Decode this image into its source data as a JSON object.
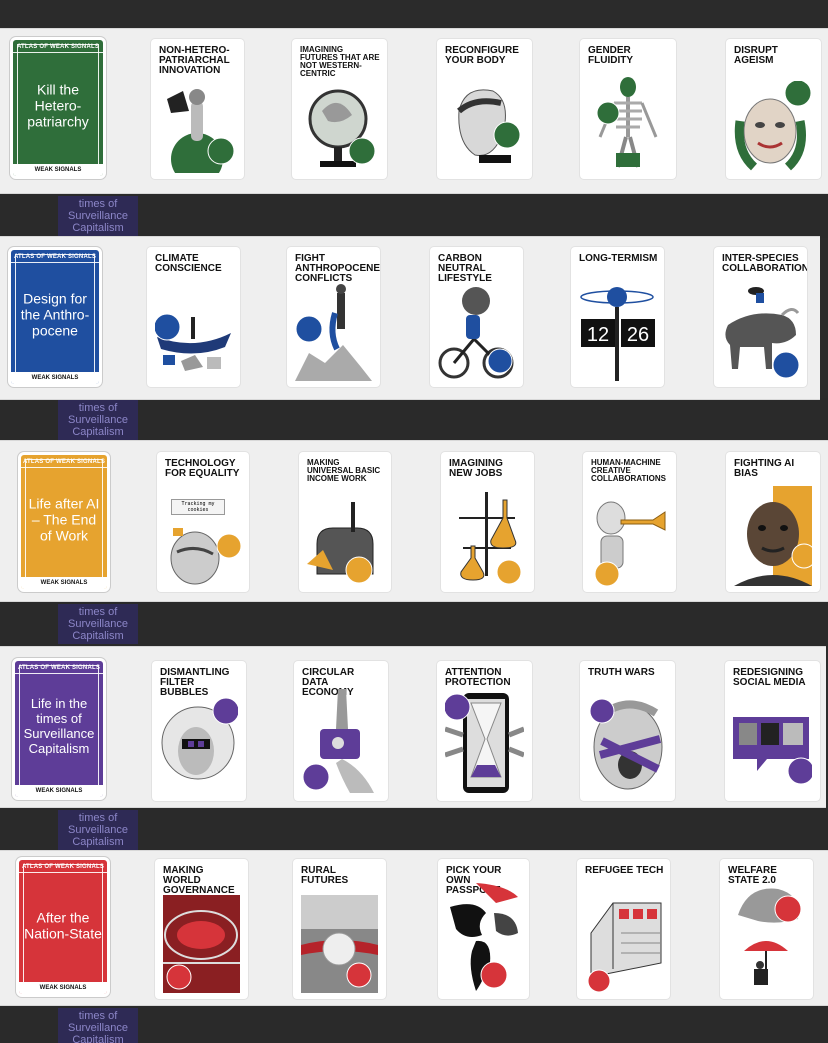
{
  "ghost_caption": "times of Surveillance Capitalism",
  "rows": [
    {
      "accent": "#2f6e3a",
      "cover": {
        "tag": "ATLAS OF WEAK SIGNALS",
        "title": "Kill the Hetero-patriarchy",
        "footer": "WEAK SIGNALS"
      },
      "cards": [
        {
          "title": "NON-HETERO-PATRIARCHAL INNOVATION",
          "icon": "astronaut-icon"
        },
        {
          "title": "IMAGINING FUTURES THAT ARE NOT WESTERN-CENTRIC",
          "icon": "globe-icon"
        },
        {
          "title": "RECONFIGURE YOUR BODY",
          "icon": "cyborg-head-icon"
        },
        {
          "title": "GENDER FLUIDITY",
          "icon": "skeleton-icon"
        },
        {
          "title": "DISRUPT AGEISM",
          "icon": "face-icon"
        }
      ]
    },
    {
      "accent": "#1f4fa0",
      "cover": {
        "tag": "ATLAS OF WEAK SIGNALS",
        "title": "Design for the Anthro-pocene",
        "footer": "WEAK SIGNALS"
      },
      "cards": [
        {
          "title": "CLIMATE CONSCIENCE",
          "icon": "canoe-icon"
        },
        {
          "title": "FIGHT ANTHROPOCENE CONFLICTS",
          "icon": "climber-icon"
        },
        {
          "title": "CARBON NEUTRAL LIFESTYLE",
          "icon": "bicycle-icon"
        },
        {
          "title": "LONG-TERMISM",
          "icon": "flip-clock-icon",
          "clock": [
            "12",
            "26"
          ]
        },
        {
          "title": "INTER-SPECIES COLLABORATION",
          "icon": "buffalo-icon"
        }
      ]
    },
    {
      "accent": "#e6a32f",
      "cover": {
        "tag": "ATLAS OF WEAK SIGNALS",
        "title": "Life after AI – The End of Work",
        "footer": "WEAK SIGNALS"
      },
      "cards": [
        {
          "title": "TECHNOLOGY FOR EQUALITY",
          "icon": "elderly-person-icon",
          "note": "Tracking my cookies"
        },
        {
          "title": "MAKING UNIVERSAL BASIC INCOME WORK",
          "icon": "mailbox-icon"
        },
        {
          "title": "IMAGINING NEW JOBS",
          "icon": "lab-flask-icon"
        },
        {
          "title": "HUMAN-MACHINE CREATIVE COLLABORATIONS",
          "icon": "robot-trumpet-icon"
        },
        {
          "title": "FIGHTING AI BIAS",
          "icon": "split-face-icon"
        }
      ]
    },
    {
      "accent": "#5e3d98",
      "cover": {
        "tag": "ATLAS OF WEAK SIGNALS",
        "title": "Life in the times of Surveillance Capitalism",
        "footer": "WEAK SIGNALS"
      },
      "cards": [
        {
          "title": "DISMANTLING FILTER BUBBLES",
          "icon": "bubble-head-icon"
        },
        {
          "title": "CIRCULAR DATA ECONOMY",
          "icon": "hands-exchange-icon"
        },
        {
          "title": "ATTENTION PROTECTION",
          "icon": "hourglass-phone-icon"
        },
        {
          "title": "TRUTH WARS",
          "icon": "shouting-face-icon"
        },
        {
          "title": "REDESIGNING SOCIAL MEDIA",
          "icon": "speech-screen-icon"
        }
      ]
    },
    {
      "accent": "#d6343a",
      "cover": {
        "tag": "ATLAS OF WEAK SIGNALS",
        "title": "After the Nation-State",
        "footer": "WEAK SIGNALS"
      },
      "cards": [
        {
          "title": "MAKING WORLD GOVERNANCE",
          "icon": "assembly-hall-icon"
        },
        {
          "title": "RURAL FUTURES",
          "icon": "field-dome-icon"
        },
        {
          "title": "PICK YOUR OWN PASSPORT",
          "icon": "world-map-icon"
        },
        {
          "title": "REFUGEE TECH",
          "icon": "tent-icon"
        },
        {
          "title": "WELFARE STATE 2.0",
          "icon": "umbrella-person-icon"
        }
      ]
    }
  ]
}
